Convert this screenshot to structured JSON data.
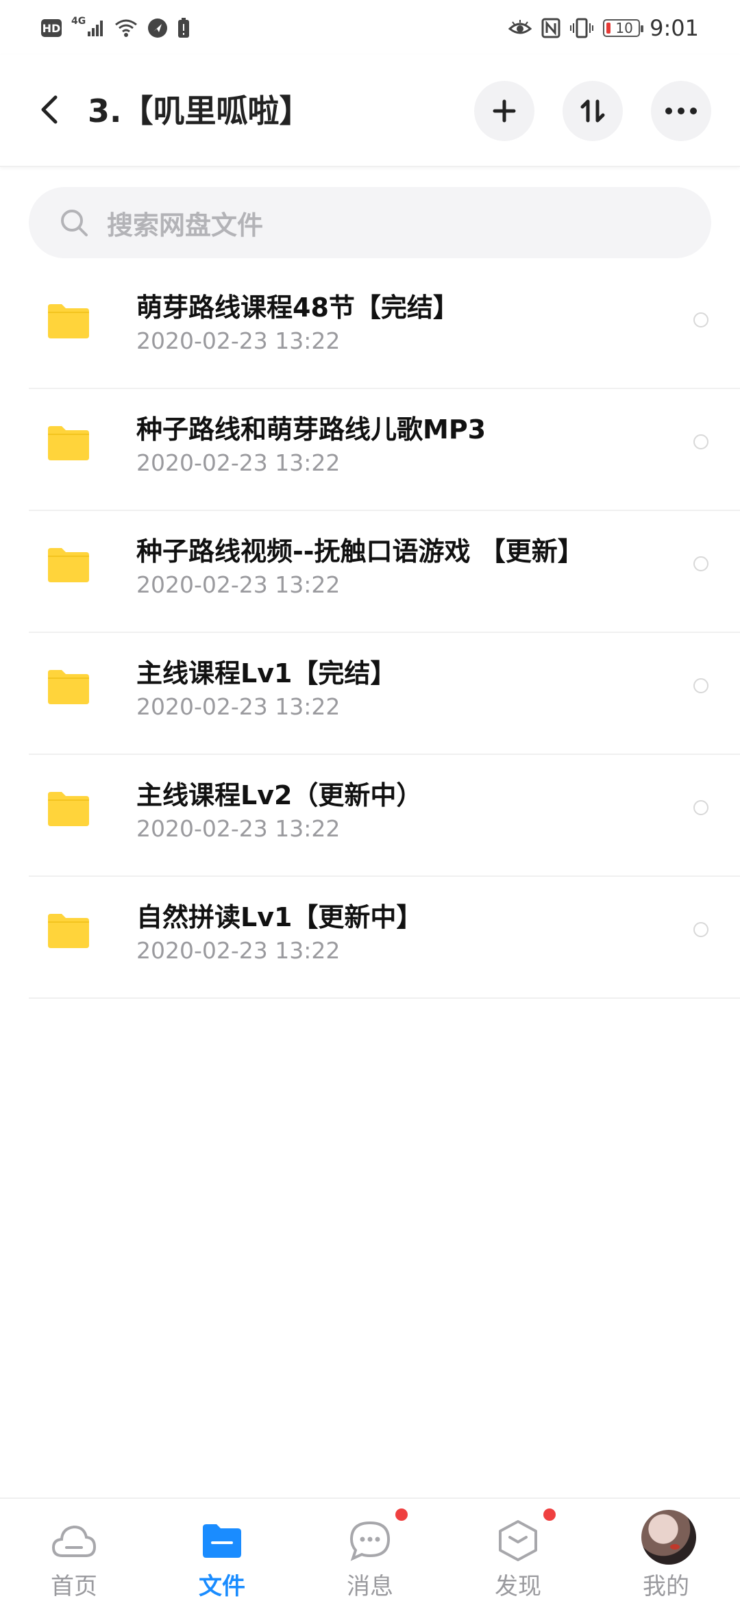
{
  "status_bar": {
    "hd": "HD",
    "network": "4G",
    "battery": "10",
    "time": "9:01"
  },
  "header": {
    "title": "3.【叽里呱啦】"
  },
  "search": {
    "placeholder": "搜索网盘文件"
  },
  "files": [
    {
      "name": "萌芽路线课程48节【完结】",
      "date": "2020-02-23  13:22",
      "icon": "folder-icon"
    },
    {
      "name": "种子路线和萌芽路线儿歌MP3",
      "date": "2020-02-23  13:22",
      "icon": "folder-icon"
    },
    {
      "name": "种子路线视频--抚触口语游戏 【更新】",
      "date": "2020-02-23  13:22",
      "icon": "folder-icon"
    },
    {
      "name": "主线课程Lv1【完结】",
      "date": "2020-02-23  13:22",
      "icon": "folder-icon"
    },
    {
      "name": "主线课程Lv2（更新中）",
      "date": "2020-02-23  13:22",
      "icon": "folder-icon"
    },
    {
      "name": "自然拼读Lv1【更新中】",
      "date": "2020-02-23  13:22",
      "icon": "folder-icon"
    }
  ],
  "bottom_nav": {
    "home": "首页",
    "files": "文件",
    "messages": "消息",
    "discover": "发现",
    "mine": "我的"
  },
  "colors": {
    "accent": "#1a8cff",
    "folder": "#ffd43b",
    "badge": "#ef4040"
  }
}
